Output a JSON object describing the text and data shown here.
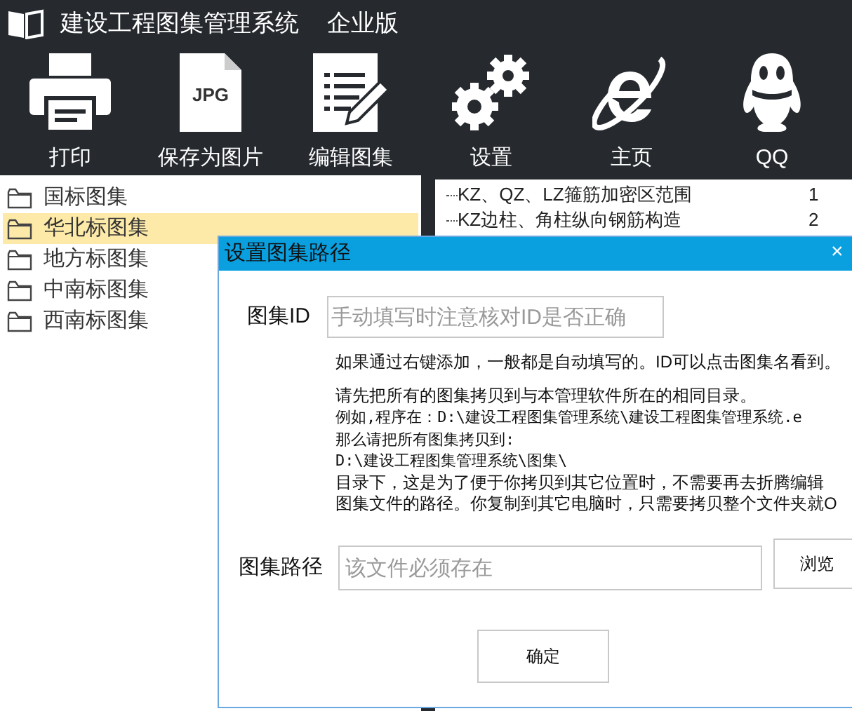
{
  "window": {
    "title": "建设工程图集管理系统",
    "edition": "企业版"
  },
  "toolbar": [
    {
      "kind": "printer",
      "label": "打印"
    },
    {
      "kind": "jpg",
      "label": "保存为图片",
      "icon_text": "JPG"
    },
    {
      "kind": "edit",
      "label": "编辑图集"
    },
    {
      "kind": "gears",
      "label": "设置"
    },
    {
      "kind": "e",
      "label": "主页"
    },
    {
      "kind": "penguin",
      "label": "QQ"
    }
  ],
  "sidebar": {
    "items": [
      {
        "label": "国标图集",
        "selected": false
      },
      {
        "label": "华北标图集",
        "selected": true
      },
      {
        "label": "地方标图集",
        "selected": false
      },
      {
        "label": "中南标图集",
        "selected": false
      },
      {
        "label": "西南标图集",
        "selected": false
      }
    ]
  },
  "list": {
    "rows": [
      {
        "title": "KZ、QZ、LZ箍筋加密区范围",
        "page": "1"
      },
      {
        "title": "KZ边柱、角柱纵向钢筋构造",
        "page": "2"
      }
    ]
  },
  "dialog": {
    "title": "设置图集路径",
    "close": "×",
    "id_label": "图集ID",
    "id_placeholder": "手动填写时注意核对ID是否正确",
    "hint": "如果通过右键添加，一般都是自动填写的。ID可以点击图集名看到。",
    "notes": [
      {
        "kind": "text",
        "text": "请先把所有的图集拷贝到与本管理软件所在的相同目录。"
      },
      {
        "kind": "mono",
        "text": "例如,程序在：D:\\建设工程图集管理系统\\建设工程图集管理系统.e"
      },
      {
        "kind": "mono",
        "text": "那么请把所有图集拷贝到:"
      },
      {
        "kind": "mono",
        "text": "D:\\建设工程图集管理系统\\图集\\"
      },
      {
        "kind": "text",
        "text": "目录下，这是为了便于你拷贝到其它位置时，不需要再去折腾编辑"
      },
      {
        "kind": "text",
        "text": "图集文件的路径。你复制到其它电脑时，只需要拷贝整个文件夹就O"
      }
    ],
    "path_label": "图集路径",
    "path_placeholder": "该文件必须存在",
    "browse": "浏览",
    "ok": "确定"
  }
}
